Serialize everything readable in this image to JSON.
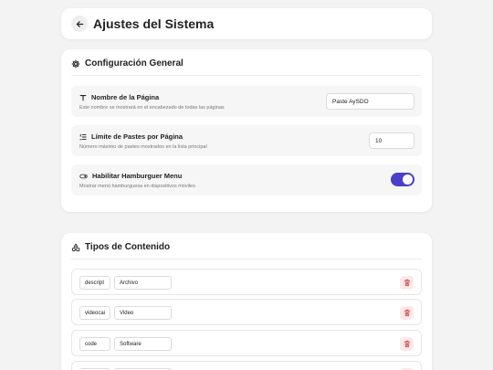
{
  "header": {
    "title": "Ajustes del Sistema"
  },
  "general": {
    "title": "Configuración General",
    "settings": [
      {
        "label": "Nombre de la Página",
        "description": "Este nombre se mostrará en el encabezado de todas las páginas",
        "value": "Paste AySDO"
      },
      {
        "label": "Límite de Pastes por Página",
        "description": "Número máximo de pastes mostrados en la lista principal",
        "value": "10"
      },
      {
        "label": "Habilitar Hamburguer Menu",
        "description": "Mostrar menú hamburguesa en dispositivos móviles",
        "enabled": true
      }
    ]
  },
  "content_types": {
    "title": "Tipos de Contenido",
    "rows": [
      {
        "key": "descript",
        "name": "Archivo"
      },
      {
        "key": "videocai",
        "name": "Video"
      },
      {
        "key": "code",
        "name": "Software"
      }
    ]
  },
  "colors": {
    "accent": "#4b3fc7",
    "danger": "#d04545",
    "danger_bg": "#fde8e8"
  }
}
